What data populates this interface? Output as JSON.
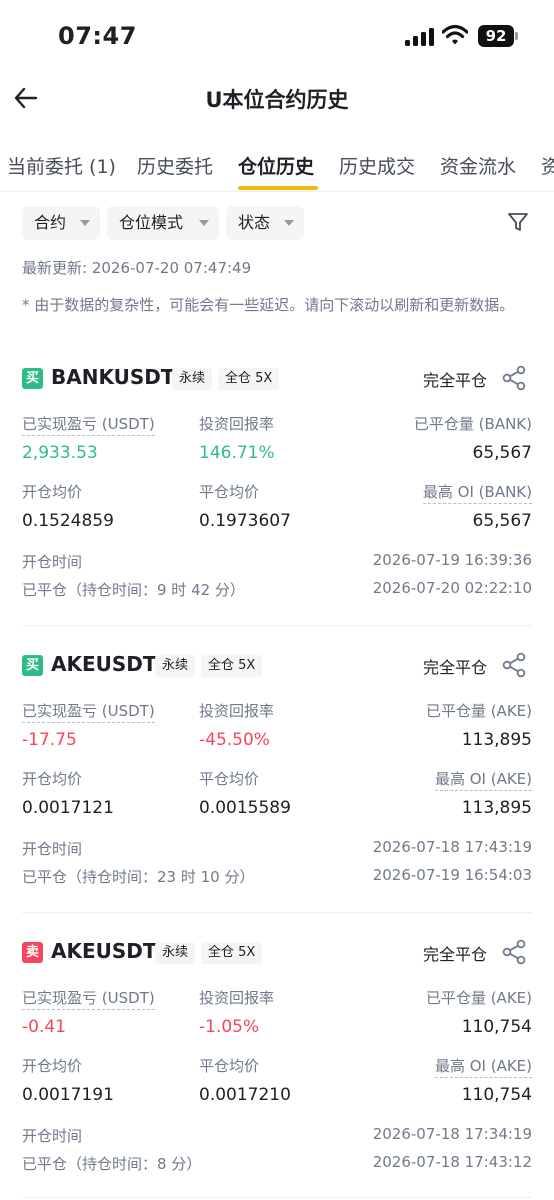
{
  "status_bar": {
    "time": "07:47",
    "battery": "92"
  },
  "header": {
    "title": "U本位合约历史"
  },
  "tabs": [
    {
      "label": "当前委托 (1)"
    },
    {
      "label": "历史委托"
    },
    {
      "label": "仓位历史"
    },
    {
      "label": "历史成交"
    },
    {
      "label": "资金流水"
    },
    {
      "label": "资"
    }
  ],
  "active_tab": "仓位历史",
  "filters": [
    {
      "label": "合约"
    },
    {
      "label": "仓位模式"
    },
    {
      "label": "状态"
    }
  ],
  "last_updated": "最新更新: 2026-07-20 07:47:49",
  "notice": "* 由于数据的复杂性，可能会有一些延迟。请向下滚动以刷新和更新数据。",
  "colors": {
    "buy": "#2ebd85",
    "sell": "#f6465d",
    "accent": "#f0b90b"
  },
  "positions": [
    {
      "side": "买",
      "symbol": "BANKUSDT",
      "tag_type": "永续",
      "tag_margin": "全仓 5X",
      "close_type": "完全平仓",
      "pnl_label": "已实现盈亏 (USDT)",
      "pnl": "2,933.53",
      "roi_label": "投资回报率",
      "roi": "146.71%",
      "closed_qty_label": "已平仓量 (BANK)",
      "closed_qty": "65,567",
      "entry_label": "开仓均价",
      "entry": "0.1524859",
      "exit_label": "平仓均价",
      "exit": "0.1973607",
      "max_oi_label": "最高 OI (BANK)",
      "max_oi": "65,567",
      "open_time_label": "开仓时间",
      "open_time": "2026-07-19 16:39:36",
      "closed_label": "已平仓（持仓时间：9 时 42 分）",
      "closed_time": "2026-07-20 02:22:10"
    },
    {
      "side": "买",
      "symbol": "AKEUSDT",
      "tag_type": "永续",
      "tag_margin": "全仓 5X",
      "close_type": "完全平仓",
      "pnl_label": "已实现盈亏 (USDT)",
      "pnl": "-17.75",
      "roi_label": "投资回报率",
      "roi": "-45.50%",
      "closed_qty_label": "已平仓量 (AKE)",
      "closed_qty": "113,895",
      "entry_label": "开仓均价",
      "entry": "0.0017121",
      "exit_label": "平仓均价",
      "exit": "0.0015589",
      "max_oi_label": "最高 OI (AKE)",
      "max_oi": "113,895",
      "open_time_label": "开仓时间",
      "open_time": "2026-07-18 17:43:19",
      "closed_label": "已平仓（持仓时间：23 时 10 分）",
      "closed_time": "2026-07-19 16:54:03"
    },
    {
      "side": "卖",
      "symbol": "AKEUSDT",
      "tag_type": "永续",
      "tag_margin": "全仓 5X",
      "close_type": "完全平仓",
      "pnl_label": "已实现盈亏 (USDT)",
      "pnl": "-0.41",
      "roi_label": "投资回报率",
      "roi": "-1.05%",
      "closed_qty_label": "已平仓量 (AKE)",
      "closed_qty": "110,754",
      "entry_label": "开仓均价",
      "entry": "0.0017191",
      "exit_label": "平仓均价",
      "exit": "0.0017210",
      "max_oi_label": "最高 OI (AKE)",
      "max_oi": "110,754",
      "open_time_label": "开仓时间",
      "open_time": "2026-07-18 17:34:19",
      "closed_label": "已平仓（持仓时间：8 分）",
      "closed_time": "2026-07-18 17:43:12"
    }
  ]
}
